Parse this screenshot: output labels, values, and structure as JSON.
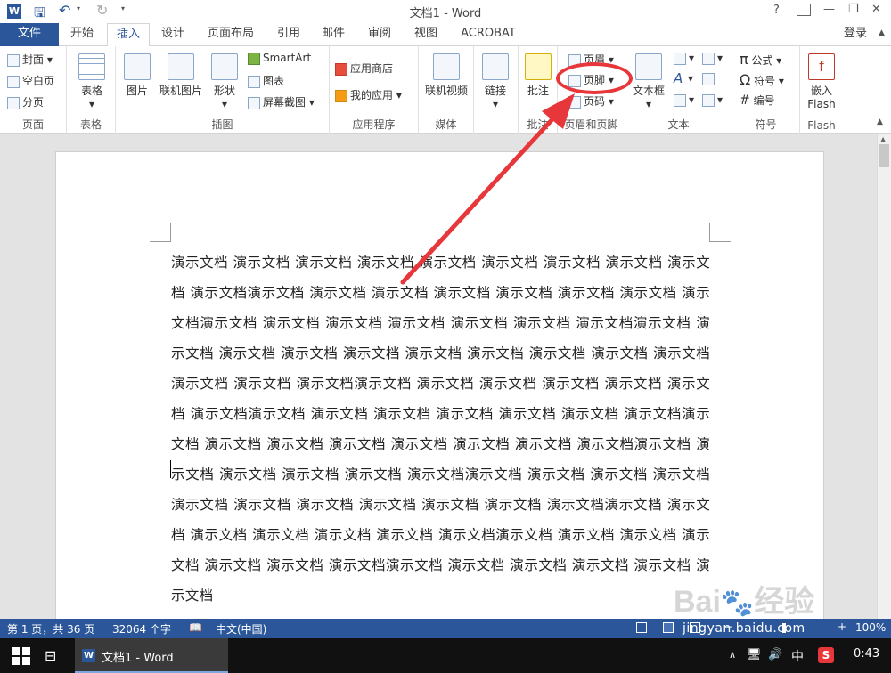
{
  "titlebar": {
    "title": "文档1 - Word",
    "help": "?",
    "minimize": "—",
    "restore": "❐",
    "close": "✕"
  },
  "tabs": {
    "file": "文件",
    "items": [
      "开始",
      "插入",
      "设计",
      "页面布局",
      "引用",
      "邮件",
      "审阅",
      "视图",
      "ACROBAT"
    ],
    "active": "插入",
    "signin": "登录"
  },
  "ribbon": {
    "pages": {
      "label": "页面",
      "cover": "封面",
      "blank": "空白页",
      "break": "分页"
    },
    "tables": {
      "label": "表格",
      "table": "表格"
    },
    "illustrations": {
      "label": "插图",
      "picture": "图片",
      "online_picture": "联机图片",
      "shapes": "形状",
      "smartart": "SmartArt",
      "chart": "图表",
      "screenshot": "屏幕截图"
    },
    "apps": {
      "label": "应用程序",
      "store": "应用商店",
      "myapps": "我的应用"
    },
    "media": {
      "label": "媒体",
      "online_video": "联机视频"
    },
    "links": {
      "label": "",
      "link": "链接"
    },
    "comments": {
      "label": "批注",
      "comment": "批注"
    },
    "header_footer": {
      "label": "页眉和页脚",
      "header": "页眉",
      "footer": "页脚",
      "page_number": "页码"
    },
    "text": {
      "label": "文本",
      "textbox": "文本框"
    },
    "symbols": {
      "label": "符号",
      "equation": "公式",
      "symbol": "符号",
      "number": "编号"
    },
    "flash": {
      "label": "Flash",
      "embed": "嵌入",
      "flash": "Flash"
    }
  },
  "document": {
    "text": "演示文档 演示文档 演示文档 演示文档 演示文档 演示文档 演示文档 演示文档 演示文档 演示文档演示文档 演示文档 演示文档 演示文档 演示文档 演示文档 演示文档 演示文档演示文档 演示文档 演示文档 演示文档 演示文档 演示文档 演示文档演示文档 演示文档 演示文档 演示文档 演示文档 演示文档 演示文档 演示文档 演示文档 演示文档 演示文档 演示文档 演示文档演示文档 演示文档 演示文档 演示文档 演示文档 演示文档 演示文档演示文档 演示文档 演示文档 演示文档 演示文档 演示文档 演示文档演示文档 演示文档 演示文档 演示文档 演示文档 演示文档 演示文档 演示文档演示文档 演示文档 演示文档 演示文档 演示文档 演示文档演示文档 演示文档 演示文档 演示文档 演示文档 演示文档 演示文档 演示文档 演示文档 演示文档 演示文档演示文档 演示文档 演示文档 演示文档 演示文档 演示文档 演示文档演示文档 演示文档 演示文档 演示文档 演示文档 演示文档 演示文档演示文档 演示文档 演示文档 演示文档 演示文档 演示文档"
  },
  "statusbar": {
    "page": "第 1 页，共 36 页",
    "words": "32064 个字",
    "language": "中文(中国)",
    "zoom": "100%"
  },
  "taskbar": {
    "app": "文档1 - Word",
    "ime": "中",
    "clock": "0:43"
  },
  "watermark": {
    "text": "jingyan.baidu.com"
  },
  "colors": {
    "accent": "#2b579a",
    "callout": "#e8373b"
  }
}
